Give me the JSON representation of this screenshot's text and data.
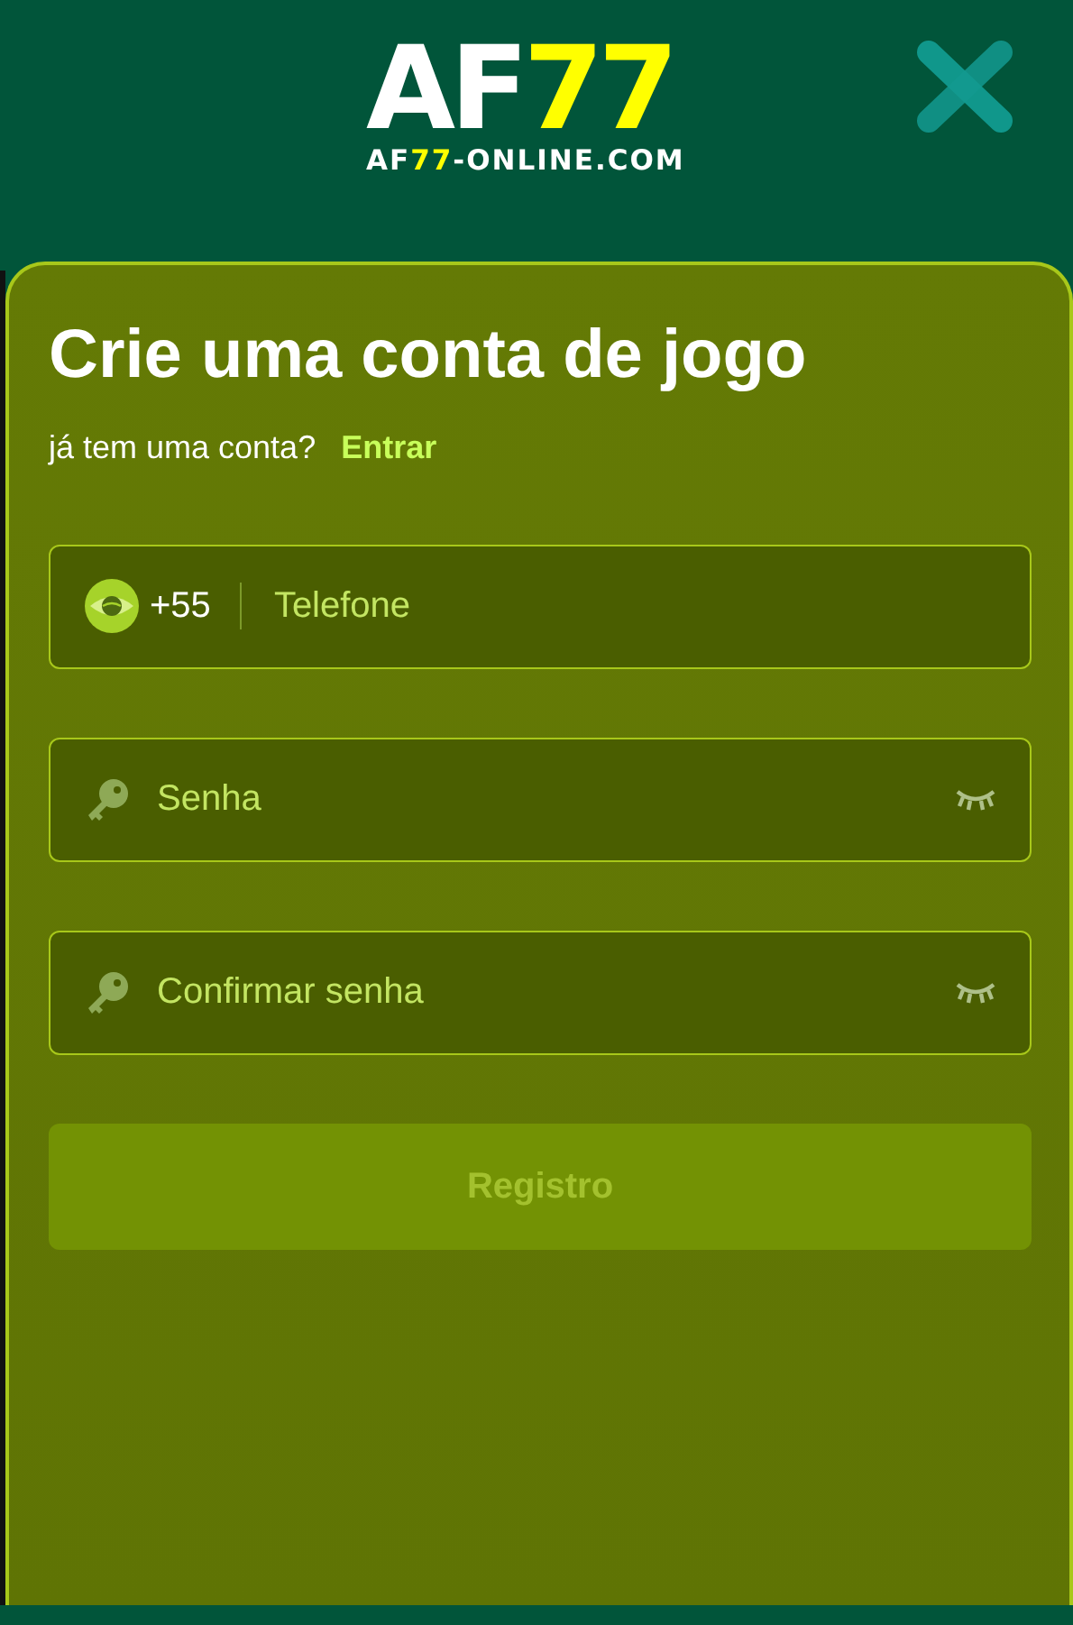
{
  "header": {
    "logo": [
      {
        "text": "AF",
        "highlight": false
      },
      {
        "text": "77",
        "highlight": true
      }
    ],
    "domain": [
      {
        "text": "AF",
        "highlight": false
      },
      {
        "text": "77",
        "highlight": true
      },
      {
        "text": "-ONLINE.COM",
        "highlight": false
      }
    ]
  },
  "form": {
    "title": "Crie uma conta de jogo",
    "prompt": "já tem uma conta?",
    "login_link": "Entrar",
    "fields": [
      {
        "kind": "phone",
        "code": "+55",
        "placeholder": "Telefone"
      },
      {
        "kind": "password",
        "placeholder": "Senha"
      },
      {
        "kind": "password",
        "placeholder": "Confirmar senha"
      }
    ],
    "submit": {
      "label": "Registro",
      "disabled": true
    }
  }
}
